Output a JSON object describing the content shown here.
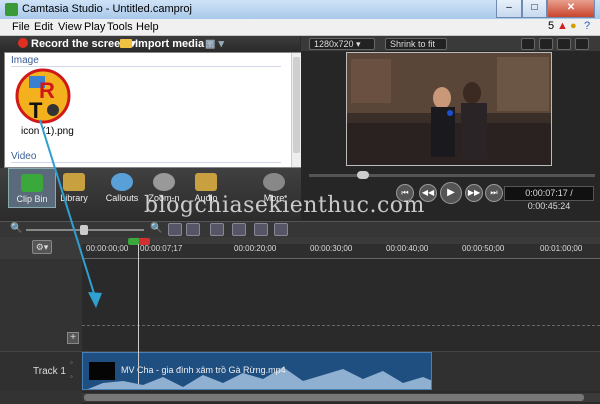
{
  "window": {
    "title": "Camtasia Studio - Untitled.camproj",
    "min": "–",
    "max": "□",
    "close": "✕"
  },
  "menu": {
    "items": [
      "File",
      "Edit",
      "View",
      "Play",
      "Tools",
      "Help"
    ],
    "notifications": "5"
  },
  "toolbar": {
    "record_label": "Record the screen",
    "import_label": "Import media"
  },
  "clipbin": {
    "image_section": "Image",
    "video_section": "Video",
    "clip_name": "icon (1).png"
  },
  "preview": {
    "resolution": "1280x720",
    "zoom": "Shrink to fit",
    "timecode": "0:00:07:17 / 0:00:45:24"
  },
  "tabs": [
    {
      "label": "Clip Bin",
      "icon": "film-icon",
      "color": "#3aa83a"
    },
    {
      "label": "Library",
      "icon": "library-icon",
      "color": "#c8a040"
    },
    {
      "label": "Callouts",
      "icon": "callout-icon",
      "color": "#5aa0d8"
    },
    {
      "label": "Zoom-n",
      "icon": "zoom-icon",
      "color": "#999999"
    },
    {
      "label": "Audio",
      "icon": "audio-icon",
      "color": "#c8a040"
    },
    {
      "label": "More",
      "icon": "more-icon",
      "color": "#888888"
    }
  ],
  "watermark": "blogchiasekienthuc.com",
  "timeline": {
    "ticks": [
      "00:00:00;00",
      "00:00:07;17",
      "00:00:20;00",
      "00:00:30;00",
      "00:00:40;00",
      "00:00:50;00",
      "00:01:00;00"
    ],
    "track_label": "Track 1",
    "clip_title": "MV Cha - gia đình xâm trồ Gà Rừng.mp4"
  },
  "colors": {
    "accent": "#1f4f80",
    "arrow": "#2fa0d0"
  }
}
